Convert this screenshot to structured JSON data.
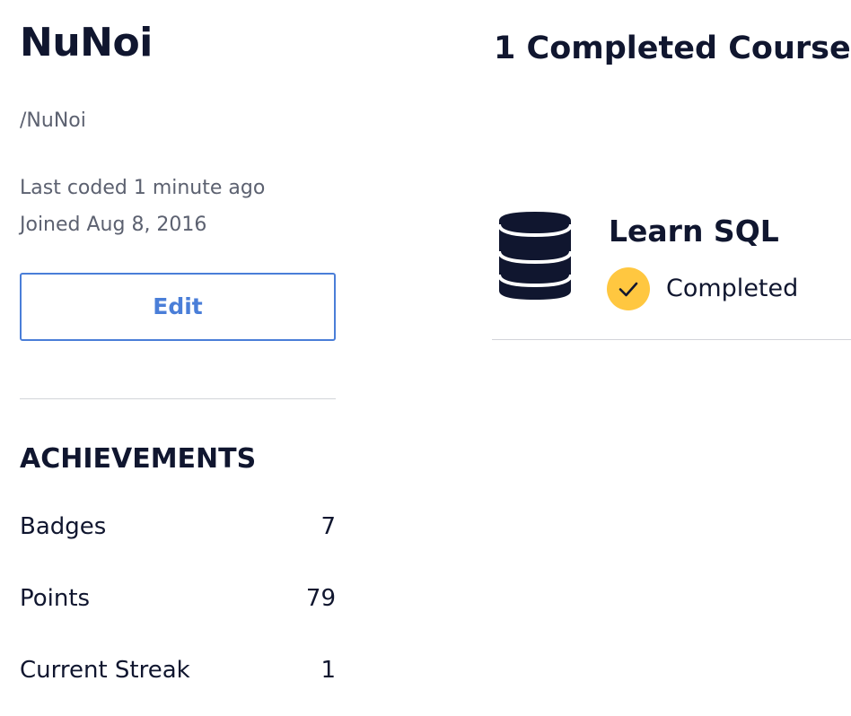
{
  "profile": {
    "username": "NuNoi",
    "handle": "/NuNoi",
    "last_coded": "Last coded 1 minute ago",
    "joined": "Joined Aug 8, 2016",
    "edit_label": "Edit"
  },
  "achievements": {
    "heading": "ACHIEVEMENTS",
    "stats": [
      {
        "label": "Badges",
        "value": "7"
      },
      {
        "label": "Points",
        "value": "79"
      },
      {
        "label": "Current Streak",
        "value": "1"
      }
    ]
  },
  "courses": {
    "heading": "1 Completed Course",
    "items": [
      {
        "title": "Learn SQL",
        "status": "Completed",
        "icon": "database-icon",
        "status_icon": "check-circle-icon"
      }
    ]
  },
  "colors": {
    "text": "#10162f",
    "muted": "#5c6170",
    "accent": "#4a7ed8",
    "check_badge": "#ffc740",
    "divider": "#d2d4d9"
  }
}
